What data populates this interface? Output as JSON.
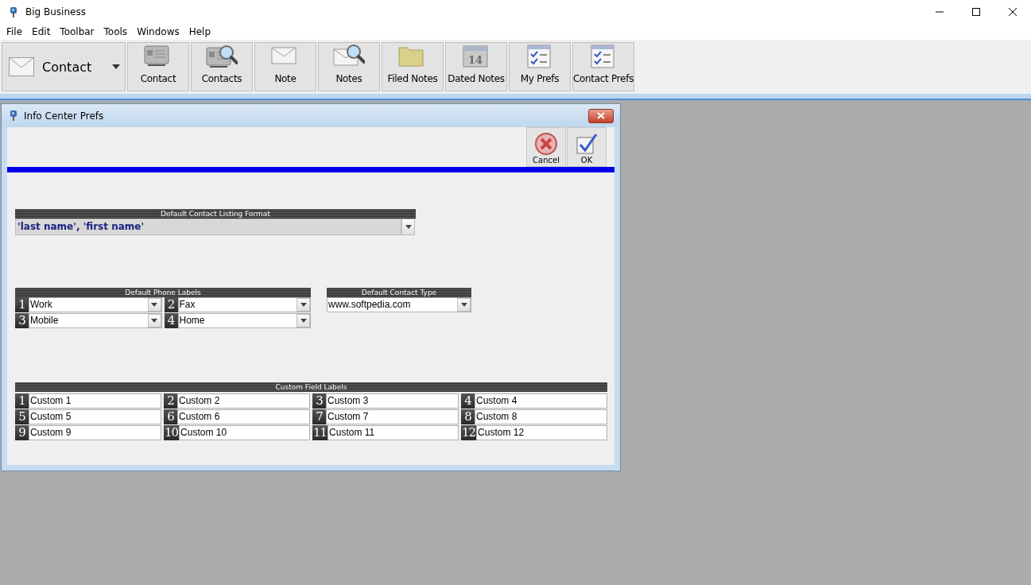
{
  "window": {
    "title": "Big Business"
  },
  "menu": [
    "File",
    "Edit",
    "Toolbar",
    "Tools",
    "Windows",
    "Help"
  ],
  "toolbar": {
    "selector": {
      "label": "Contact"
    },
    "buttons": [
      {
        "label": "Contact",
        "kind": "card"
      },
      {
        "label": "Contacts",
        "kind": "card-search"
      },
      {
        "label": "Note",
        "kind": "envelope"
      },
      {
        "label": "Notes",
        "kind": "envelope-search"
      },
      {
        "label": "Filed Notes",
        "kind": "folder"
      },
      {
        "label": "Dated Notes",
        "kind": "calendar",
        "day": "14"
      },
      {
        "label": "My Prefs",
        "kind": "checklist"
      },
      {
        "label": "Contact Prefs",
        "kind": "checklist"
      }
    ]
  },
  "dialog": {
    "title": "Info Center Prefs",
    "buttons": [
      {
        "label": "Cancel",
        "kind": "cancel"
      },
      {
        "label": "OK",
        "kind": "ok"
      }
    ],
    "listing_format": {
      "title": "Default Contact Listing Format",
      "value": "'last name', 'first name'"
    },
    "phone_labels": {
      "title": "Default Phone Labels",
      "items": [
        {
          "number": "1",
          "value": "Work"
        },
        {
          "number": "2",
          "value": "Fax"
        },
        {
          "number": "3",
          "value": "Mobile"
        },
        {
          "number": "4",
          "value": "Home"
        }
      ]
    },
    "contact_type": {
      "title": "Default Contact Type",
      "value": "www.softpedia.com"
    },
    "custom_fields": {
      "title": "Custom Field Labels",
      "items": [
        {
          "number": "1",
          "value": "Custom 1"
        },
        {
          "number": "2",
          "value": "Custom 2"
        },
        {
          "number": "3",
          "value": "Custom 3"
        },
        {
          "number": "4",
          "value": "Custom 4"
        },
        {
          "number": "5",
          "value": "Custom 5"
        },
        {
          "number": "6",
          "value": "Custom 6"
        },
        {
          "number": "7",
          "value": "Custom 7"
        },
        {
          "number": "8",
          "value": "Custom 8"
        },
        {
          "number": "9",
          "value": "Custom 9"
        },
        {
          "number": "10",
          "value": "Custom 10"
        },
        {
          "number": "11",
          "value": "Custom 11"
        },
        {
          "number": "12",
          "value": "Custom 12"
        }
      ]
    }
  }
}
